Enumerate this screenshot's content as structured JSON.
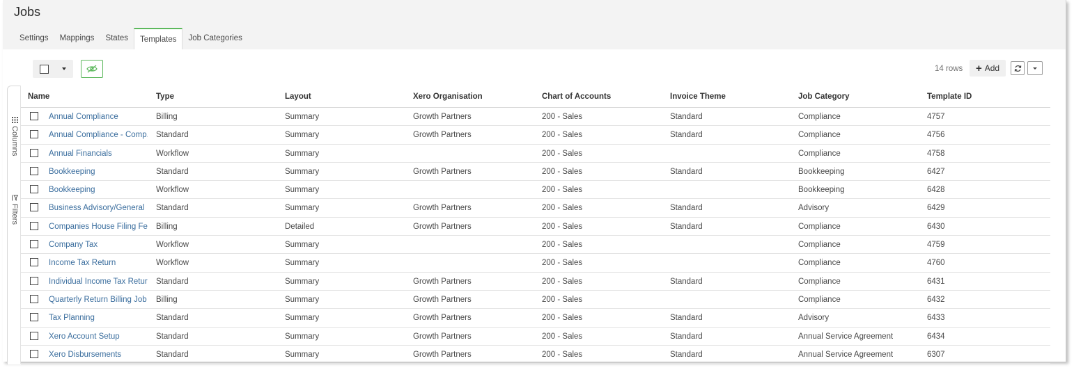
{
  "page": {
    "title": "Jobs"
  },
  "tabs": [
    {
      "label": "Settings"
    },
    {
      "label": "Mappings"
    },
    {
      "label": "States"
    },
    {
      "label": "Templates"
    },
    {
      "label": "Job Categories"
    }
  ],
  "active_tab": "Templates",
  "toolbar": {
    "rows_count": "14 rows",
    "add_label": "Add"
  },
  "side_panel": {
    "columns_label": "Columns",
    "filters_label": "Filters"
  },
  "table": {
    "columns": [
      "Name",
      "Type",
      "Layout",
      "Xero Organisation",
      "Chart of Accounts",
      "Invoice Theme",
      "Job Category",
      "Template ID"
    ],
    "rows": [
      [
        "Annual Compliance",
        "Billing",
        "Summary",
        "Growth Partners",
        "200 - Sales",
        "Standard",
        "Compliance",
        "4757"
      ],
      [
        "Annual Compliance - Comp...",
        "Standard",
        "Summary",
        "Growth Partners",
        "200 - Sales",
        "Standard",
        "Compliance",
        "4756"
      ],
      [
        "Annual Financials",
        "Workflow",
        "Summary",
        "",
        "200 - Sales",
        "",
        "Compliance",
        "4758"
      ],
      [
        "Bookkeeping",
        "Standard",
        "Summary",
        "Growth Partners",
        "200 - Sales",
        "Standard",
        "Bookkeeping",
        "6427"
      ],
      [
        "Bookkeeping",
        "Workflow",
        "Summary",
        "",
        "200 - Sales",
        "",
        "Bookkeeping",
        "6428"
      ],
      [
        "Business Advisory/General",
        "Standard",
        "Summary",
        "Growth Partners",
        "200 - Sales",
        "Standard",
        "Advisory",
        "6429"
      ],
      [
        "Companies House Filing Fee",
        "Billing",
        "Detailed",
        "Growth Partners",
        "200 - Sales",
        "Standard",
        "Compliance",
        "6430"
      ],
      [
        "Company Tax",
        "Workflow",
        "Summary",
        "",
        "200 - Sales",
        "",
        "Compliance",
        "4759"
      ],
      [
        "Income Tax Return",
        "Workflow",
        "Summary",
        "",
        "200 - Sales",
        "",
        "Compliance",
        "4760"
      ],
      [
        "Individual Income Tax Return",
        "Standard",
        "Summary",
        "Growth Partners",
        "200 - Sales",
        "Standard",
        "Compliance",
        "6431"
      ],
      [
        "Quarterly Return Billing Job",
        "Billing",
        "Summary",
        "Growth Partners",
        "200 - Sales",
        "",
        "Compliance",
        "6432"
      ],
      [
        "Tax Planning",
        "Standard",
        "Summary",
        "Growth Partners",
        "200 - Sales",
        "Standard",
        "Advisory",
        "6433"
      ],
      [
        "Xero Account Setup",
        "Standard",
        "Summary",
        "Growth Partners",
        "200 - Sales",
        "Standard",
        "Annual Service Agreement",
        "6434"
      ],
      [
        "Xero Disbursements",
        "Standard",
        "Summary",
        "Growth Partners",
        "200 - Sales",
        "Standard",
        "Annual Service Agreement",
        "6307"
      ]
    ]
  },
  "icons": {
    "hide": "eye-slash-icon",
    "add": "plus-icon",
    "refresh": "refresh-icon",
    "more": "chevron-down-icon",
    "columns": "grid-icon",
    "filters": "filter-icon"
  },
  "colors": {
    "accent": "#5cb85c",
    "link": "#3b6e9e",
    "header_bg": "#f3f3f3"
  }
}
